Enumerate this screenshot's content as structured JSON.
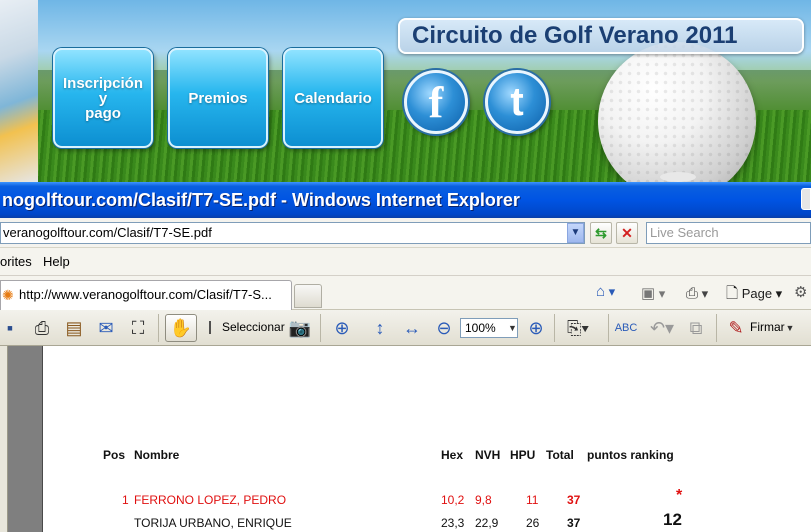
{
  "banner": {
    "title": "Circuito de Golf Verano 2011",
    "nav": {
      "inscripcion": "Inscripción\ny\npago",
      "premios": "Premios",
      "calendario": "Calendario"
    },
    "social": {
      "facebook_glyph": "f",
      "twitter_glyph": "t"
    },
    "colors": {
      "button_blue": "#1ba6e6",
      "title_text": "#1b3f73"
    }
  },
  "browser": {
    "title": "nogolftour.com/Clasif/T7-SE.pdf - Windows Internet Explorer",
    "address": "veranogolftour.com/Clasif/T7-SE.pdf",
    "search_placeholder": "Live Search",
    "menu": {
      "favorites": "orites",
      "help": "Help"
    },
    "tab": {
      "label": "http://www.veranogolftour.com/Clasif/T7-S..."
    },
    "commands": {
      "page": "Page"
    },
    "icons": [
      "home-icon",
      "feeds-icon",
      "print-icon",
      "page-icon",
      "tools-icon"
    ]
  },
  "pdf_toolbar": {
    "select_label": "Seleccionar",
    "zoom": "100%",
    "sign_label": "Firmar",
    "icons": [
      "save-icon",
      "print-icon",
      "pages-icon",
      "email-icon",
      "find-icon",
      "hand-icon",
      "select-icon",
      "snapshot-icon",
      "zoom-in-icon",
      "fit-height-icon",
      "fit-width-icon",
      "zoom-out-minus-icon",
      "zoom-plus-icon",
      "export-icon",
      "spell-icon",
      "undo-icon",
      "copy-icon",
      "sign-icon"
    ]
  },
  "document": {
    "headers": {
      "pos": "Pos",
      "nombre": "Nombre",
      "hex": "Hex",
      "nvh": "NVH",
      "hpu": "HPU",
      "total": "Total",
      "puntos": "puntos ranking"
    },
    "rows": [
      {
        "pos": "1",
        "nombre": "FERRONO LOPEZ, PEDRO",
        "hex": "10,2",
        "nvh": "9,8",
        "hpu": "11",
        "total": "37",
        "puntos": "*",
        "color": "#e01010"
      },
      {
        "pos": "",
        "nombre": "TORIJA URBANO, ENRIQUE",
        "hex": "23,3",
        "nvh": "22,9",
        "hpu": "26",
        "total": "37",
        "puntos": "12",
        "color": "#111111"
      }
    ]
  }
}
